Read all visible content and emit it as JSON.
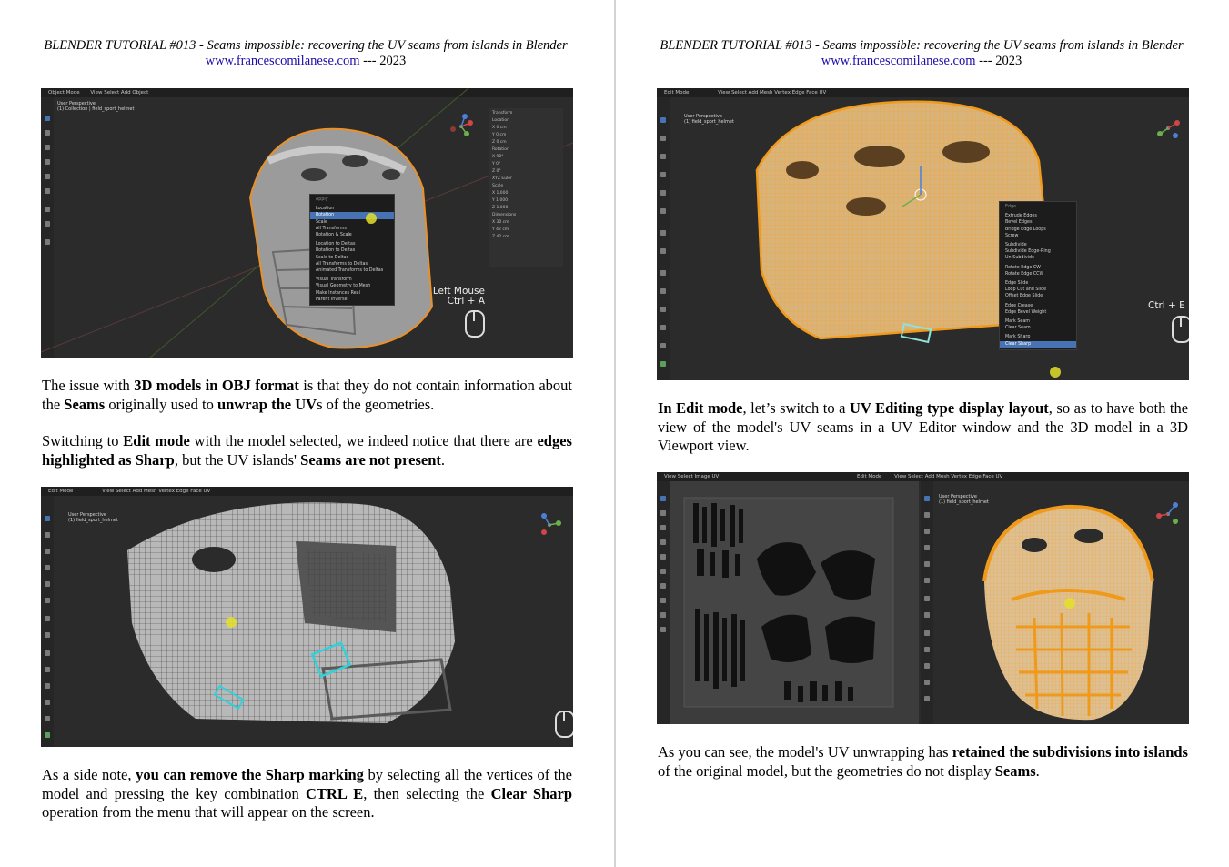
{
  "header": {
    "title": "BLENDER TUTORIAL #013 - Seams impossible: recovering the UV seams from islands in Blender",
    "site": "www.francescomilanese.com",
    "year_suffix": " --- 2023"
  },
  "left": {
    "shot1": {
      "mode": "Object Mode",
      "menus": "View   Select   Add   Object",
      "viewport_label_1": "User Perspective",
      "viewport_label_2": "(1) Collection | field_sport_helmet",
      "popup_title": "Apply",
      "popup_items": [
        "Location",
        "Rotation",
        "Scale",
        "All Transforms",
        "Rotation & Scale",
        "Location to Deltas",
        "Rotation to Deltas",
        "Scale to Deltas",
        "All Transforms to Deltas",
        "Animated Transforms to Deltas",
        "Visual Transform",
        "Visual Geometry to Mesh",
        "Make Instances Real",
        "Parent Inverse"
      ],
      "panel_title": "Transform",
      "panel_rows": [
        "Location",
        "X  0 cm",
        "Y  0 cm",
        "Z  0 cm",
        "Rotation",
        "X  90°",
        "Y  0°",
        "Z  0°",
        "XYZ Euler",
        "Scale",
        "X  1.000",
        "Y  1.000",
        "Z  1.000",
        "Dimensions",
        "X  30 cm",
        "Y  42 cm",
        "Z  42 cm"
      ],
      "shortcut_line1": "Left Mouse",
      "shortcut_line2": "Ctrl + A"
    },
    "para1": {
      "t1": "The issue with ",
      "b1": "3D models in OBJ format",
      "t2": " is that they do not contain information about the ",
      "b2": "Seams",
      "t3": " originally used to ",
      "b3": "unwrap the UV",
      "t4": "s of the geometries."
    },
    "para2": {
      "t1": "Switching to ",
      "b1": "Edit mode",
      "t2": " with the model selected, we indeed notice that there are ",
      "b2": "edges highlighted as Sharp",
      "t3": ", but the UV islands' ",
      "b3": "Seams are not present",
      "t4": "."
    },
    "shot2": {
      "mode": "Edit Mode",
      "menus": "View   Select   Add   Mesh   Vertex   Edge   Face   UV",
      "viewport_label_1": "User Perspective",
      "viewport_label_2": "(1) field_sport_helmet"
    },
    "para3": {
      "t1": "As a side note, ",
      "b1": "you can remove the Sharp marking",
      "t2": " by selecting all the vertices of the model and pressing the key combination ",
      "b2": "CTRL E",
      "t3": ", then selecting the ",
      "b3": "Clear Sharp",
      "t4": " operation from the menu that will appear on the screen."
    }
  },
  "right": {
    "shot3": {
      "mode": "Edit Mode",
      "menus": "View   Select   Add   Mesh   Vertex   Edge   Face   UV",
      "viewport_label_1": "User Perspective",
      "viewport_label_2": "(1) field_sport_helmet",
      "popup_title": "Edge",
      "popup_items": [
        "Extrude Edges",
        "Bevel Edges",
        "Bridge Edge Loops",
        "Screw",
        "Subdivide",
        "Subdivide Edge-Ring",
        "Un-Subdivide",
        "Rotate Edge CW",
        "Rotate Edge CCW",
        "Edge Slide",
        "Loop Cut and Slide",
        "Offset Edge Slide",
        "Edge Crease",
        "Edge Bevel Weight",
        "Mark Seam",
        "Clear Seam",
        "Mark Sharp",
        "Clear Sharp"
      ],
      "shortcut_line1": "Ctrl + E"
    },
    "para4": {
      "b1": "In Edit mode",
      "t1": ", let’s switch to a ",
      "b2": "UV Editing type display layout",
      "t2": ", so as to have both the view of the model's UV seams in a UV Editor window and the 3D model in a 3D Viewport view."
    },
    "shot4": {
      "uv_menus": "View   Select   Image   UV",
      "mode": "Edit Mode",
      "menus": "View   Select   Add   Mesh   Vertex   Edge   Face   UV",
      "viewport_label_1": "User Perspective",
      "viewport_label_2": "(1) field_sport_helmet"
    },
    "para5": {
      "t1": "As you can see, the model's UV unwrapping has ",
      "b1": "retained the subdivisions into islands",
      "t2": " of the original model, but the geometries do not display ",
      "b2": "Seams",
      "t3": "."
    }
  },
  "colors": {
    "ui_dark": "#2b2b2b",
    "selection_orange": "#f09a1c",
    "sharp_cyan": "#32d0d8",
    "menu_highlight": "#4772b3",
    "link": "#1a0dab"
  }
}
